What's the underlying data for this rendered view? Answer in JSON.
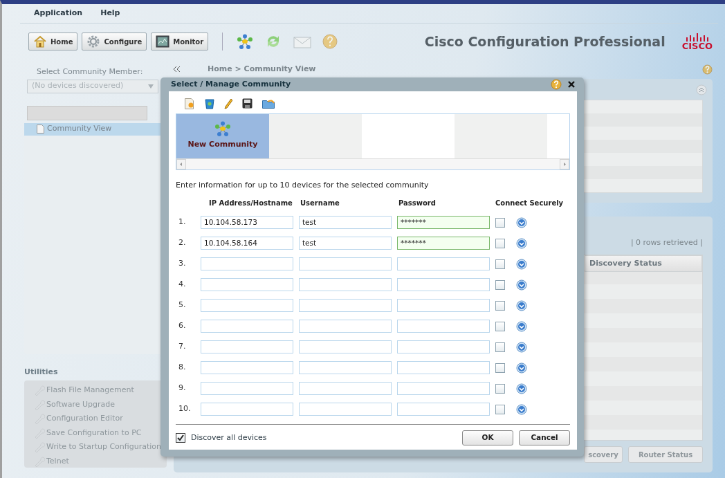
{
  "menu": [
    {
      "label": "Application"
    },
    {
      "label": "Help"
    }
  ],
  "toolbar": {
    "buttons": [
      {
        "label": "Home",
        "kind": "home"
      },
      {
        "label": "Configure",
        "kind": "configure"
      },
      {
        "label": "Monitor",
        "kind": "monitor"
      }
    ],
    "product_title": "Cisco Configuration Professional",
    "logo": "CISCO"
  },
  "sidebar": {
    "member_label": "Select Community Member:",
    "member_combo": "(No devices discovered)",
    "tree": [
      {
        "label": "Community View",
        "selected": true
      }
    ],
    "utilities_title": "Utilities",
    "utilities": [
      {
        "label": "Flash File Management",
        "disabled": true
      },
      {
        "label": "Software Upgrade",
        "disabled": true
      },
      {
        "label": "Configuration Editor",
        "disabled": true
      },
      {
        "label": "Save Configuration to PC",
        "disabled": true
      },
      {
        "label": "Write to Startup Configuration",
        "disabled": true
      },
      {
        "label": "Telnet",
        "disabled": true
      }
    ]
  },
  "breadcrumb": "Home > Community View",
  "main": {
    "rows_retrieved": "| 0 rows retrieved |",
    "column": "Discovery Status",
    "buttons": [
      "scovery",
      "Router Status"
    ]
  },
  "dialog": {
    "title": "Select / Manage Community",
    "communities": [
      {
        "label": "New Community",
        "selected": true
      }
    ],
    "instruction": "Enter information for up to 10 devices for the selected community",
    "columns": [
      "IP Address/Hostname",
      "Username",
      "Password",
      "Connect Securely"
    ],
    "devices": [
      {
        "number": "1.",
        "ip": "10.104.58.173",
        "username": "test",
        "password": "*******",
        "secure": false
      },
      {
        "number": "2.",
        "ip": "10.104.58.164",
        "username": "test",
        "password": "*******",
        "secure": false
      },
      {
        "number": "3.",
        "secure": false
      },
      {
        "number": "4.",
        "secure": false
      },
      {
        "number": "5.",
        "secure": false
      },
      {
        "number": "6.",
        "secure": false
      },
      {
        "number": "7.",
        "secure": false
      },
      {
        "number": "8.",
        "secure": false
      },
      {
        "number": "9.",
        "secure": false
      },
      {
        "number": "10.",
        "secure": false
      }
    ],
    "discover_all": {
      "label": "Discover all devices",
      "checked": true
    },
    "ok": "OK",
    "cancel": "Cancel"
  }
}
